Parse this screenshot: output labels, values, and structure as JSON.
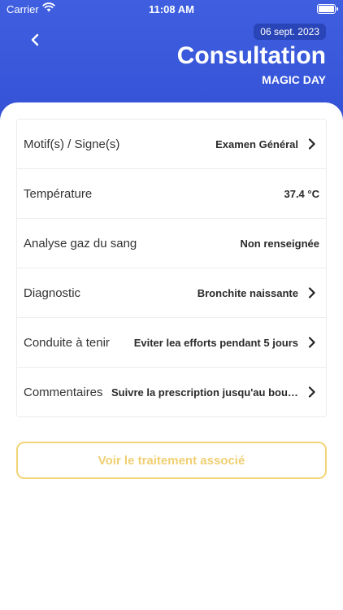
{
  "status_bar": {
    "carrier": "Carrier",
    "time": "11:08 AM"
  },
  "header": {
    "date": "06 sept. 2023",
    "title": "Consultation",
    "subtitle": "MAGIC DAY",
    "background_color": "#3350d4"
  },
  "rows": [
    {
      "label": "Motif(s) / Signe(s)",
      "value": "Examen Général",
      "chevron": true
    },
    {
      "label": "Température",
      "value": "37.4 °C",
      "chevron": false
    },
    {
      "label": "Analyse gaz du sang",
      "value": "Non renseignée",
      "chevron": false
    },
    {
      "label": "Diagnostic",
      "value": "Bronchite naissante",
      "chevron": true
    },
    {
      "label": "Conduite à tenir",
      "value": "Eviter lea efforts pendant 5 jours",
      "chevron": true
    },
    {
      "label": "Commentaires",
      "value": "Suivre la prescription jusqu'au bout...",
      "chevron": true
    }
  ],
  "actions": {
    "treatment_label": "Voir le traitement associé",
    "accent_color": "#f2d477"
  }
}
